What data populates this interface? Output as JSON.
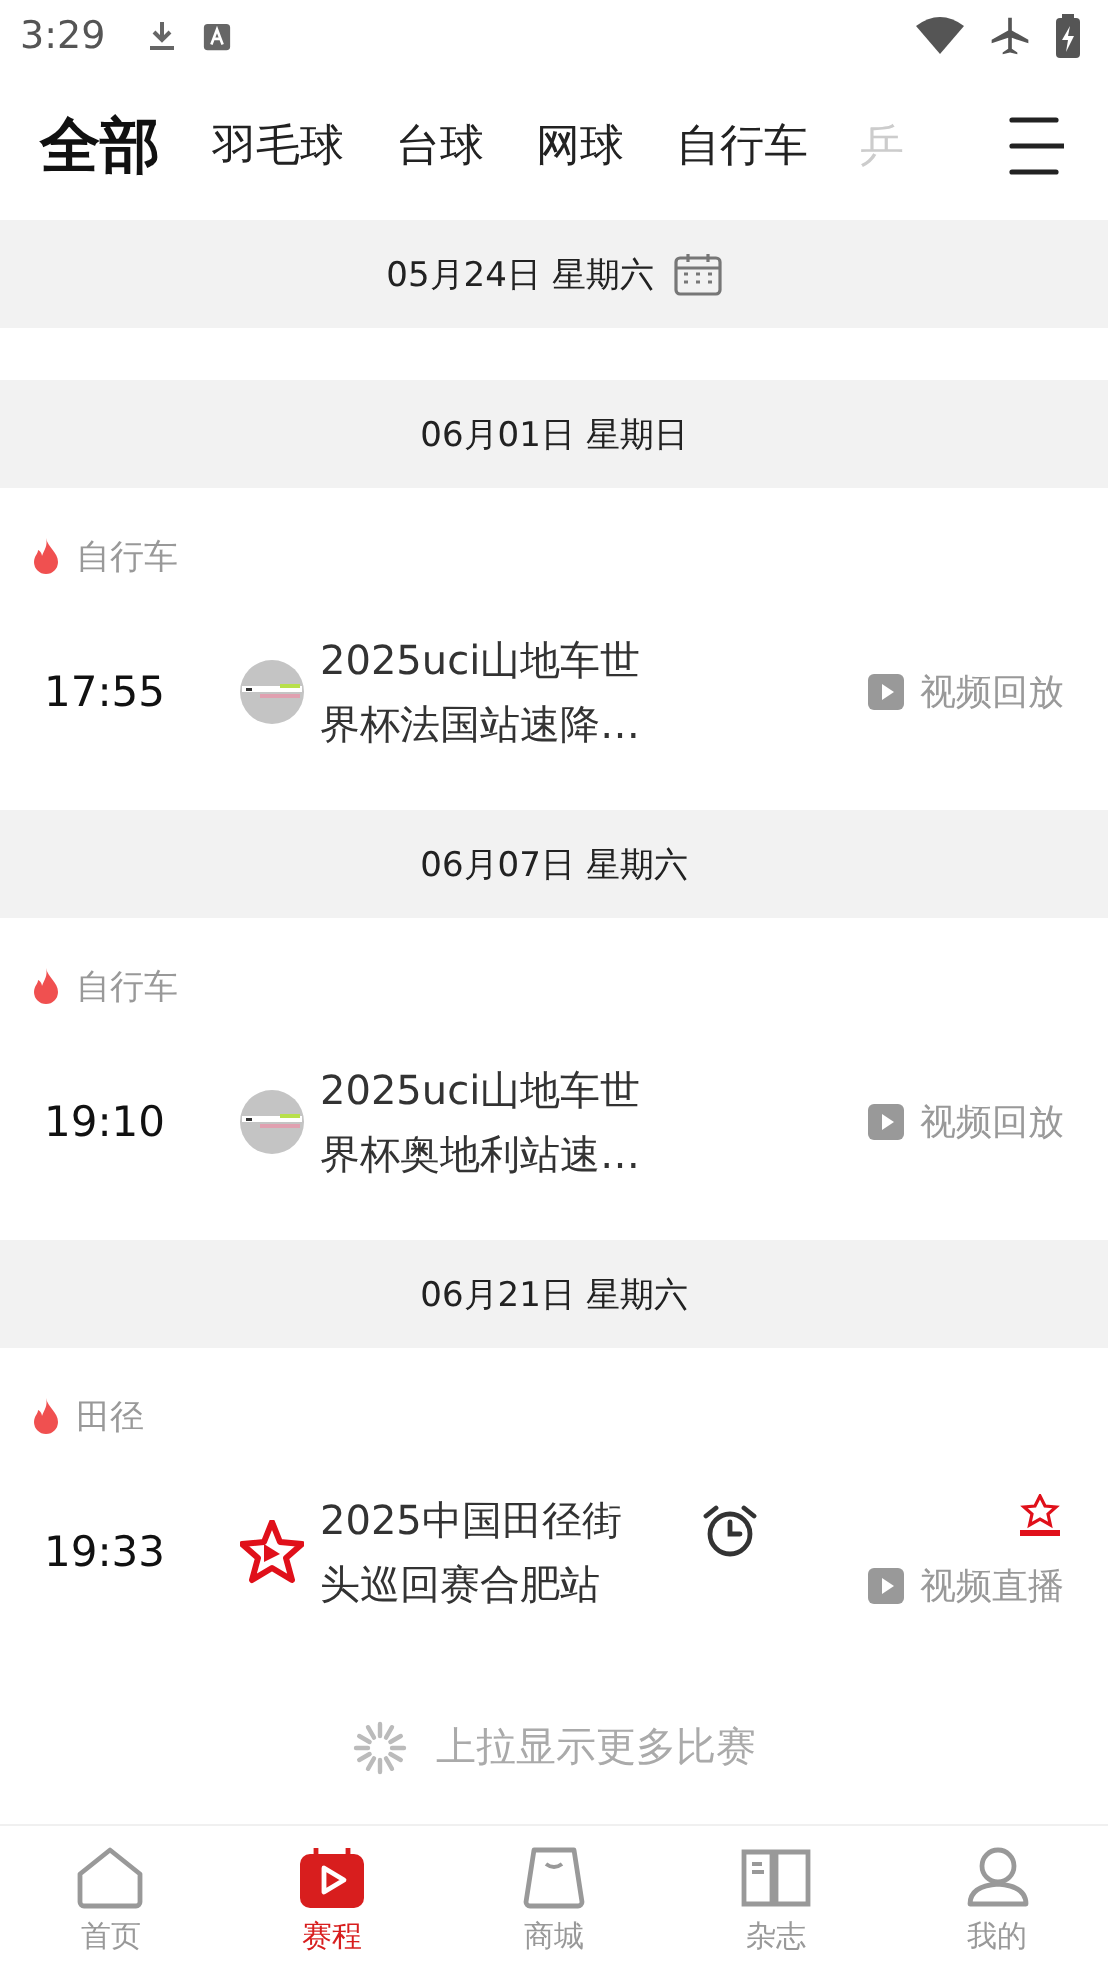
{
  "status_bar": {
    "time": "3:29"
  },
  "sport_tabs": [
    {
      "label": "全部",
      "selected": true,
      "faded": false
    },
    {
      "label": "羽毛球",
      "selected": false,
      "faded": false
    },
    {
      "label": "台球",
      "selected": false,
      "faded": false
    },
    {
      "label": "网球",
      "selected": false,
      "faded": false
    },
    {
      "label": "自行车",
      "selected": false,
      "faded": false
    },
    {
      "label": "乒",
      "selected": false,
      "faded": true
    }
  ],
  "days": [
    {
      "date": "05月24日 星期六",
      "calendar_icon": true
    },
    {
      "date": "06月01日 星期日",
      "calendar_icon": false,
      "events": [
        {
          "sport": "自行车",
          "time": "17:55",
          "title": "2025uci山地车世界杯法国站速降…",
          "kind": "badge",
          "alarm": false,
          "side_logo": false,
          "action": "视频回放"
        }
      ]
    },
    {
      "date": "06月07日 星期六",
      "calendar_icon": false,
      "events": [
        {
          "sport": "自行车",
          "time": "19:10",
          "title": "2025uci山地车世界杯奥地利站速…",
          "kind": "badge",
          "alarm": false,
          "side_logo": false,
          "action": "视频回放"
        }
      ]
    },
    {
      "date": "06月21日 星期六",
      "calendar_icon": false,
      "events": [
        {
          "sport": "田径",
          "time": "19:33",
          "title": "2025中国田径街头巡回赛合肥站",
          "kind": "star",
          "alarm": true,
          "side_logo": true,
          "action": "视频直播"
        }
      ]
    }
  ],
  "load_more": "上拉显示更多比赛",
  "bottom_nav": [
    {
      "label": "首页",
      "selected": false
    },
    {
      "label": "赛程",
      "selected": true
    },
    {
      "label": "商城",
      "selected": false
    },
    {
      "label": "杂志",
      "selected": false
    },
    {
      "label": "我的",
      "selected": false
    }
  ]
}
